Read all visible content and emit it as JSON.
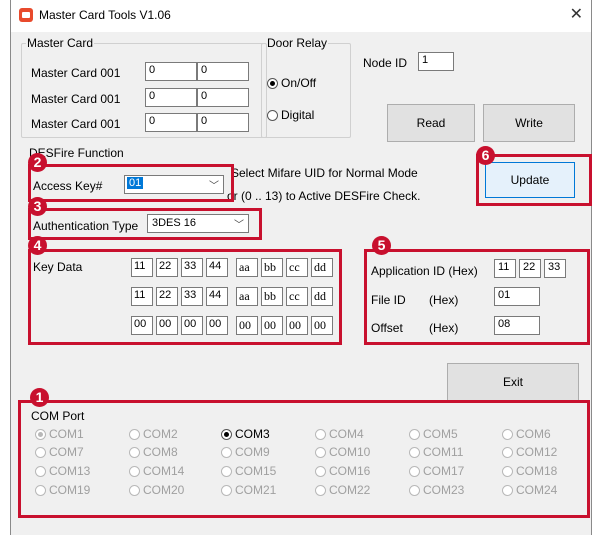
{
  "window": {
    "title": "Master Card Tools V1.06",
    "close_icon": "close-icon"
  },
  "master_card": {
    "legend": "Master Card",
    "rows": [
      {
        "label": "Master Card 001",
        "v1": "0",
        "v2": "0"
      },
      {
        "label": "Master Card 001",
        "v1": "0",
        "v2": "0"
      },
      {
        "label": "Master Card 001",
        "v1": "0",
        "v2": "0"
      }
    ]
  },
  "door_relay": {
    "legend": "Door Relay",
    "option1": "On/Off",
    "option2": "Digital",
    "selected": "On/Off"
  },
  "node": {
    "label": "Node ID",
    "value": "1"
  },
  "buttons": {
    "read": "Read",
    "write": "Write",
    "update": "Update",
    "exit": "Exit"
  },
  "desfire": {
    "legend": "DESFire Function",
    "access_key_label": "Access Key#",
    "access_key_value": "01",
    "info_line1": "Select  Mifare UID for Normal Mode",
    "info_line2": "or (0 .. 13) to Active DESFire Check.",
    "auth_label": "Authentication Type",
    "auth_value": "3DES 16"
  },
  "key_data": {
    "label": "Key Data",
    "rows": [
      [
        "11",
        "22",
        "33",
        "44",
        "aa",
        "bb",
        "cc",
        "dd"
      ],
      [
        "11",
        "22",
        "33",
        "44",
        "aa",
        "bb",
        "cc",
        "dd"
      ],
      [
        "00",
        "00",
        "00",
        "00",
        "00",
        "00",
        "00",
        "00"
      ]
    ]
  },
  "application": {
    "app_id_label": "Application ID  (Hex)",
    "app_id": [
      "11",
      "22",
      "33"
    ],
    "file_id_label": "File ID",
    "file_id_hex": "(Hex)",
    "file_id": "01",
    "offset_label": "Offset",
    "offset_hex": "(Hex)",
    "offset": "08"
  },
  "com_port": {
    "legend": "COM Port",
    "selected": "COM3",
    "ports": [
      "COM1",
      "COM2",
      "COM3",
      "COM4",
      "COM5",
      "COM6",
      "COM7",
      "COM8",
      "COM9",
      "COM10",
      "COM11",
      "COM12",
      "COM13",
      "COM14",
      "COM15",
      "COM16",
      "COM17",
      "COM18",
      "COM19",
      "COM20",
      "COM21",
      "COM22",
      "COM23",
      "COM24"
    ]
  },
  "annotations": {
    "b1": "1",
    "b2": "2",
    "b3": "3",
    "b4": "4",
    "b5": "5",
    "b6": "6"
  },
  "colors": {
    "annotation_red": "#c8102e",
    "selection_blue": "#0078d7",
    "window_bg": "#f0f0f0"
  }
}
